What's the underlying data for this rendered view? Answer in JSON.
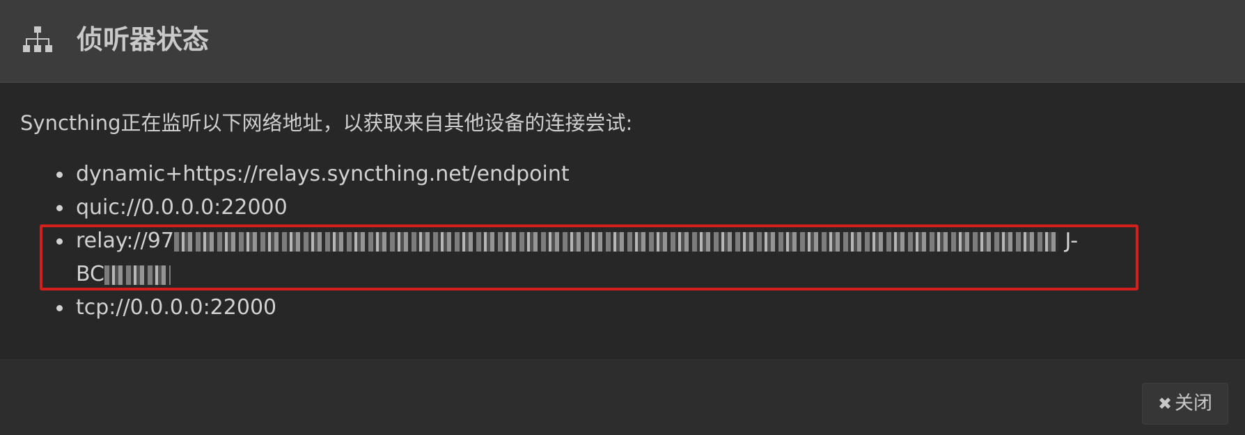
{
  "dialog": {
    "title": "侦听器状态",
    "icon": "sitemap-icon"
  },
  "body": {
    "intro": "Syncthing正在监听以下网络地址，以获取来自其他设备的连接尝试:",
    "addresses": [
      "dynamic+https://relays.syncthing.net/endpoint",
      "quic://0.0.0.0:22000",
      "relay://97",
      "tcp://0.0.0.0:22000"
    ],
    "relay_tail_end": "J-",
    "relay_line2_prefix": "BC"
  },
  "footer": {
    "close_label": "关闭",
    "close_icon": "close-icon"
  },
  "colors": {
    "highlight": "#d4201a",
    "header_bg": "#3c3c3c",
    "body_bg": "#272727"
  }
}
